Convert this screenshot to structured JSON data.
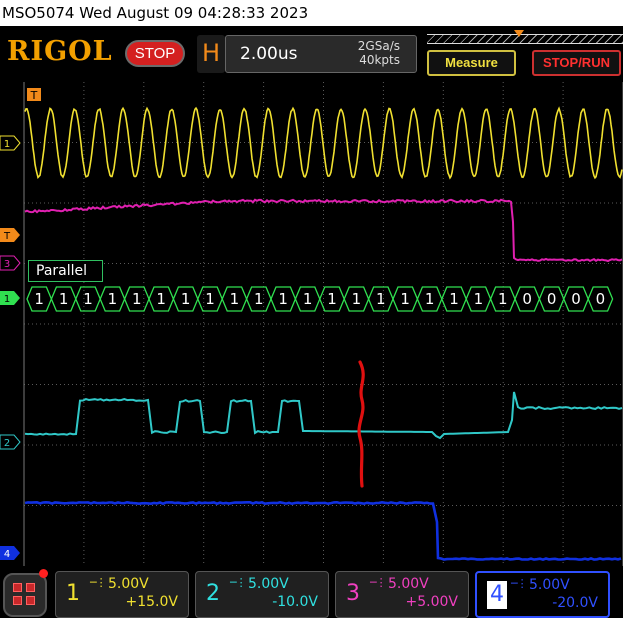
{
  "title_bar": {
    "text": "MSO5074  Wed August 09 04:28:33 2023"
  },
  "toolbar": {
    "logo": "RIGOL",
    "run_state": "STOP",
    "horizontal_letter": "H",
    "timebase": "2.00us",
    "sample_rate": "2GSa/s",
    "memory_depth": "40kpts",
    "measure_label": "Measure",
    "stoprun_label": "STOP/RUN"
  },
  "markers": {
    "trigger_top": "T",
    "ch1": "1",
    "trigger_level": "T",
    "ch3": "3",
    "bus": "1",
    "ch2": "2",
    "ch4": "4"
  },
  "decode": {
    "label": "Parallel",
    "values": [
      "1",
      "1",
      "1",
      "1",
      "1",
      "1",
      "1",
      "1",
      "1",
      "1",
      "1",
      "1",
      "1",
      "1",
      "1",
      "1",
      "1",
      "1",
      "1",
      "1",
      "0",
      "0",
      "0",
      "0"
    ]
  },
  "channels": [
    {
      "num": "1",
      "scale": "5.00V",
      "offset": "+15.0V",
      "color": "#f0e030",
      "coupling_icon": "dc-coupling-icon"
    },
    {
      "num": "2",
      "scale": "5.00V",
      "offset": "-10.0V",
      "color": "#30e0e0",
      "coupling_icon": "dc-coupling-icon"
    },
    {
      "num": "3",
      "scale": "5.00V",
      "offset": "+5.00V",
      "color": "#f040c0",
      "coupling_icon": "dc-coupling-icon"
    },
    {
      "num": "4",
      "scale": "5.00V",
      "offset": "-20.0V",
      "color": "#3050ff",
      "coupling_icon": "dc-coupling-icon"
    }
  ],
  "colors": {
    "ch1": "#f0e030",
    "ch2": "#30c8c8",
    "ch3": "#e020b0",
    "ch4": "#1030e0",
    "bus": "#30e050",
    "trigger": "#f28a1a",
    "grid": "#5a5a5a",
    "annotation": "#e01010"
  }
}
